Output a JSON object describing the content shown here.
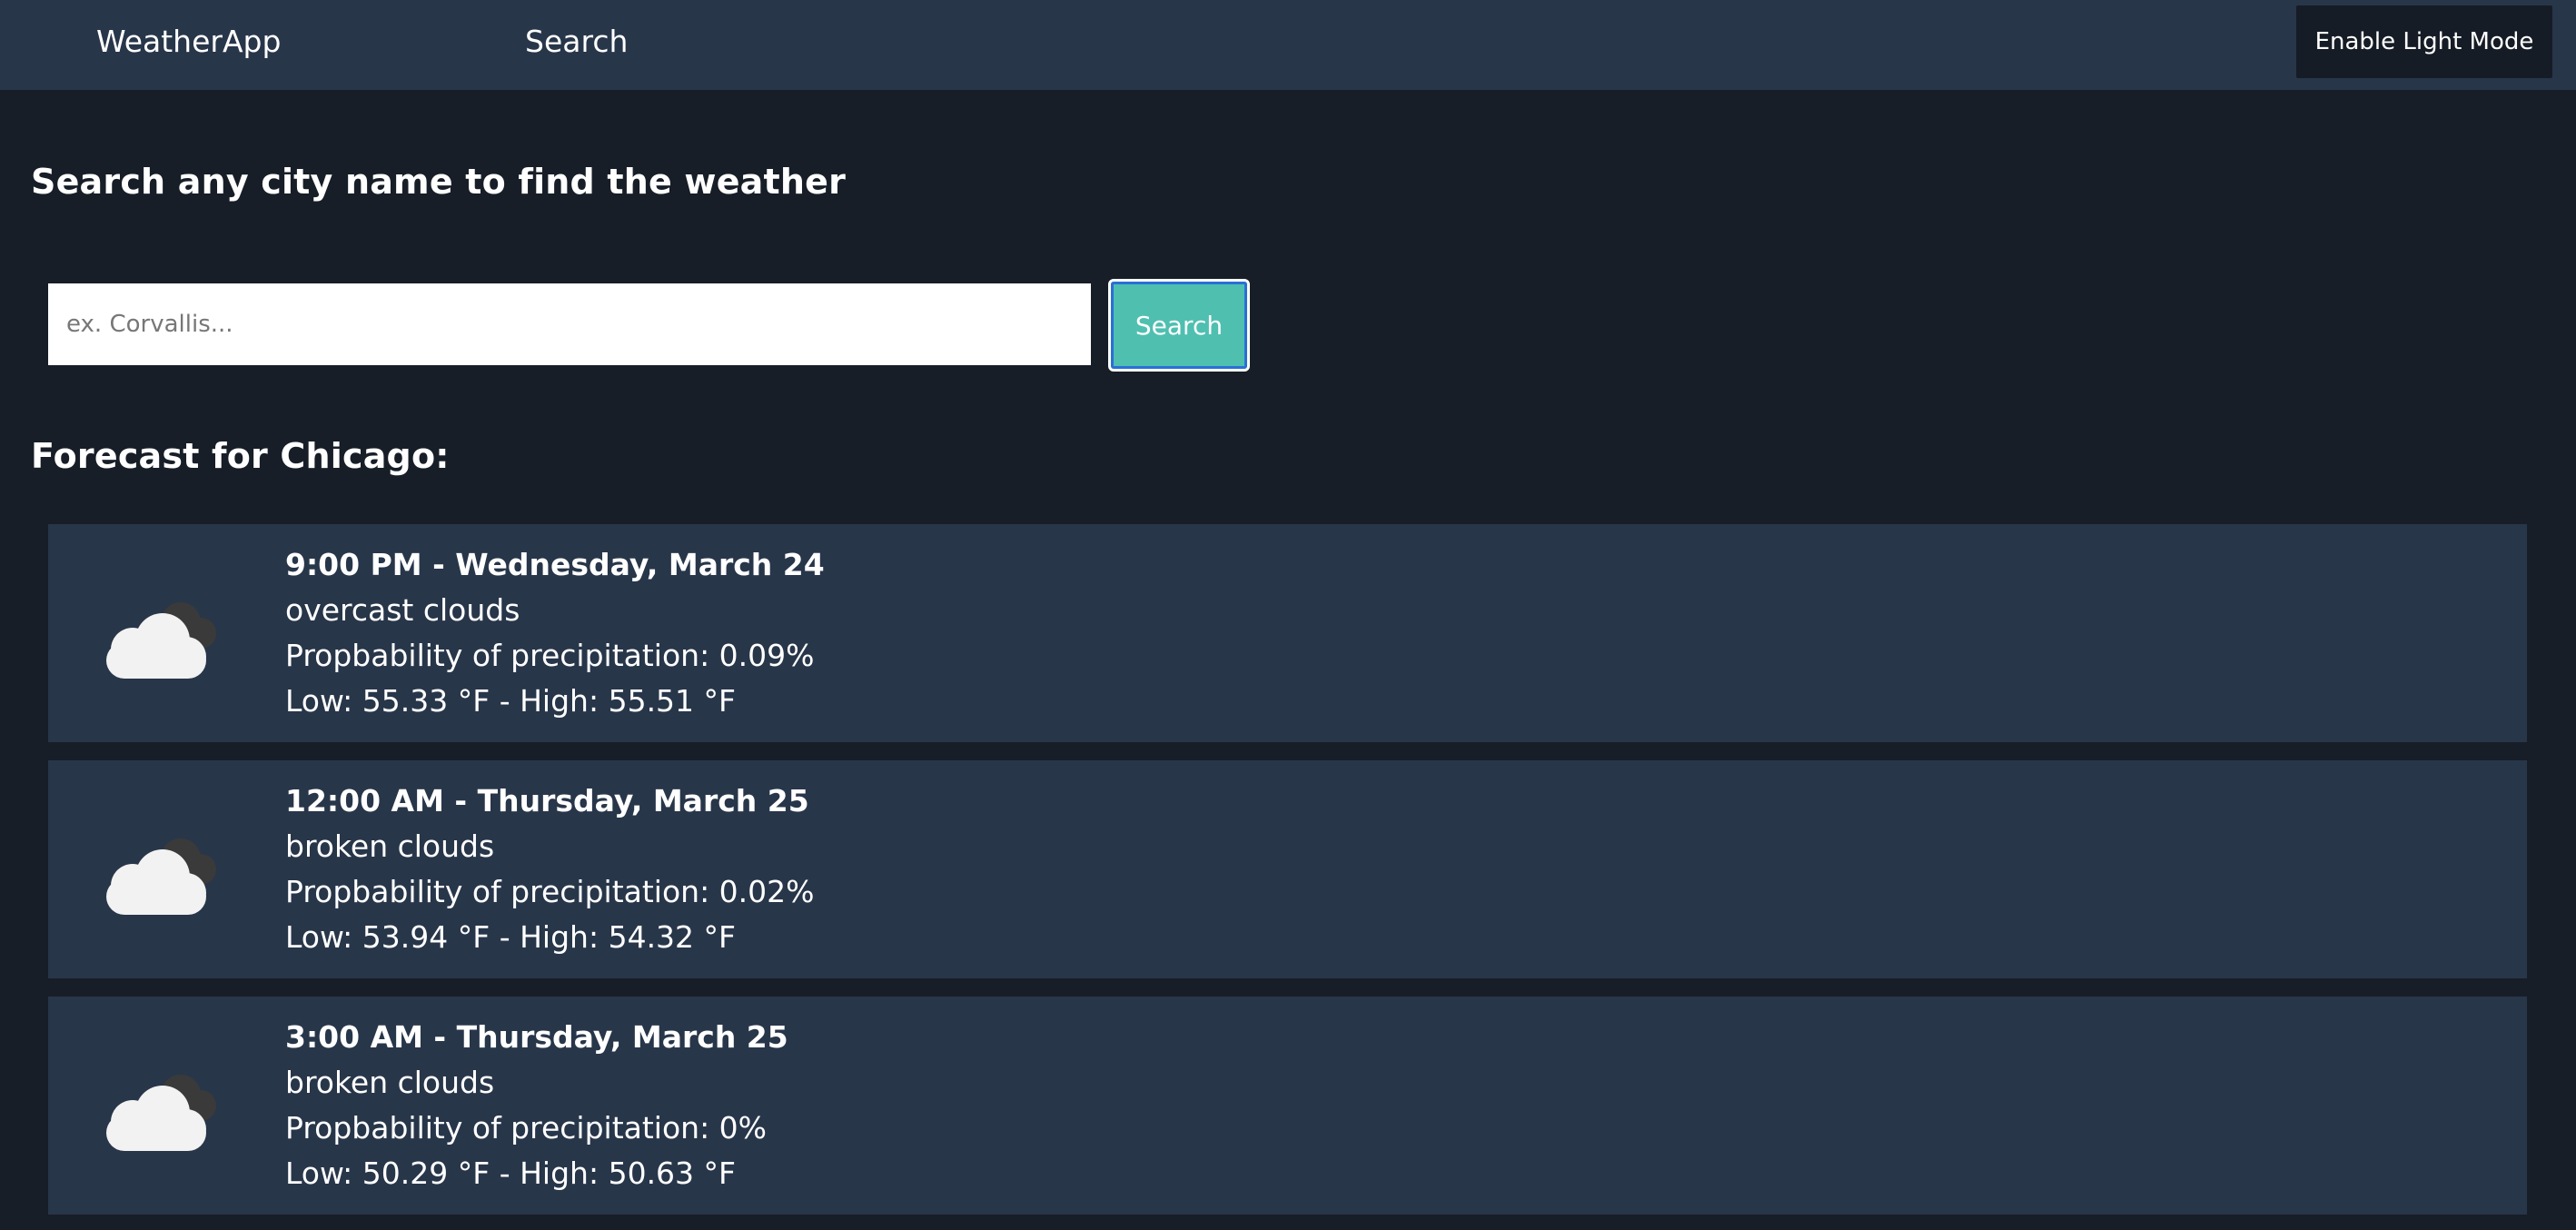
{
  "nav": {
    "brand": "WeatherApp",
    "search_link": "Search",
    "theme_button": "Enable Light Mode"
  },
  "search": {
    "heading": "Search any city name to find the weather",
    "placeholder": "ex. Corvallis...",
    "value": "",
    "button_label": "Search"
  },
  "forecast": {
    "heading": "Forecast for Chicago:",
    "items": [
      {
        "title": "9:00 PM - Wednesday, March 24",
        "condition": "overcast clouds",
        "precipitation": "Propbability of precipitation: 0.09%",
        "temps": "Low: 55.33 °F - High: 55.51 °F",
        "icon": "cloud-icon"
      },
      {
        "title": "12:00 AM - Thursday, March 25",
        "condition": "broken clouds",
        "precipitation": "Propbability of precipitation: 0.02%",
        "temps": "Low: 53.94 °F - High: 54.32 °F",
        "icon": "cloud-icon"
      },
      {
        "title": "3:00 AM - Thursday, March 25",
        "condition": "broken clouds",
        "precipitation": "Propbability of precipitation: 0%",
        "temps": "Low: 50.29 °F - High: 50.63 °F",
        "icon": "cloud-icon"
      }
    ]
  },
  "colors": {
    "background": "#171e27",
    "navbar": "#28364a",
    "card": "#28364a",
    "accent": "#4fbfb0",
    "dark_button": "#161c25"
  }
}
